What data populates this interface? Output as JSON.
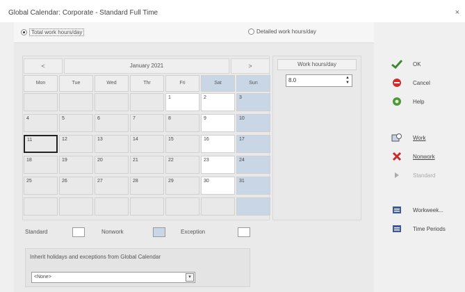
{
  "window": {
    "title": "Global Calendar: Corporate - Standard Full Time",
    "close_glyph": "×"
  },
  "mode": {
    "total_label": "Total work hours/day",
    "detailed_label": "Detailed work hours/day",
    "selected": "total"
  },
  "calendar": {
    "month_label": "January 2021",
    "prev_label": "<",
    "next_label": ">",
    "day_headers": [
      "Mon",
      "Tue",
      "Wed",
      "Thr",
      "Fri",
      "Sat",
      "Sun"
    ],
    "weeks": [
      [
        "",
        "",
        "",
        "",
        "1",
        "2",
        "3"
      ],
      [
        "4",
        "5",
        "6",
        "7",
        "8",
        "9",
        "10"
      ],
      [
        "11",
        "12",
        "13",
        "14",
        "15",
        "16",
        "17"
      ],
      [
        "18",
        "19",
        "20",
        "21",
        "22",
        "23",
        "24"
      ],
      [
        "25",
        "26",
        "27",
        "28",
        "29",
        "30",
        "31"
      ],
      [
        "",
        "",
        "",
        "",
        "",
        "",
        ""
      ]
    ],
    "selected_day": "11"
  },
  "work_hours": {
    "header": "Work hours/day",
    "value": "8.0"
  },
  "legend": {
    "standard": "Standard",
    "nonwork": "Nonwork",
    "exception": "Exception",
    "colors": {
      "standard": "#ffffff",
      "nonwork": "#c8d6e5",
      "exception": "#ffffff"
    }
  },
  "import": {
    "label": "Inherit holidays and exceptions from Global Calendar",
    "selected": "<None>"
  },
  "buttons": {
    "ok": "OK",
    "cancel": "Cancel",
    "help": "Help",
    "work": "Work",
    "nonwork": "Nonwork",
    "standard": "Standard",
    "workweek": "Workweek...",
    "time_periods": "Time Periods"
  },
  "colors": {
    "ok_check": "#3a8a2e",
    "cancel_red": "#d42a2a",
    "help_green": "#4a9a3a",
    "nonwork_x": "#c92a2a",
    "icon_blue": "#3e5a9a"
  }
}
